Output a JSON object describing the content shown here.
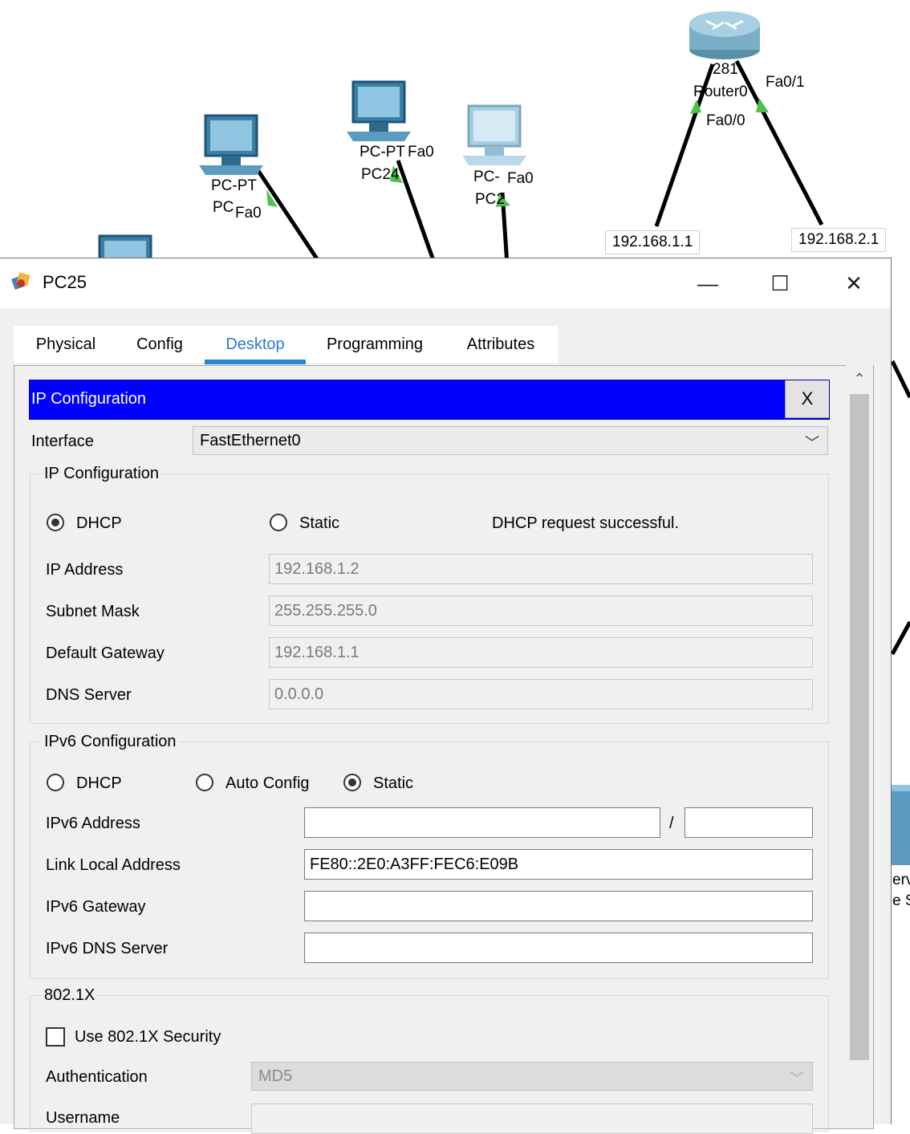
{
  "topology": {
    "router": {
      "model": "281",
      "name": "Router0",
      "port_left": "Fa0/0",
      "port_right": "Fa0/1"
    },
    "pcs": [
      {
        "model": "PC-PT",
        "name": "PC",
        "port": "Fa0"
      },
      {
        "model": "PC-PT",
        "name": "PC24",
        "port": "Fa0"
      },
      {
        "model": "PC-",
        "name": "PC2",
        "port": "Fa0"
      }
    ],
    "ip_labels": [
      "192.168.1.1",
      "192.168.2.1"
    ],
    "edge_text": [
      "erv",
      "e S"
    ]
  },
  "window": {
    "title": "PC25",
    "minimize_glyph": "—",
    "maximize_glyph": "☐",
    "close_glyph": "✕"
  },
  "tabs": [
    {
      "label": "Physical"
    },
    {
      "label": "Config"
    },
    {
      "label": "Desktop",
      "active": true
    },
    {
      "label": "Programming"
    },
    {
      "label": "Attributes"
    }
  ],
  "ipconfig": {
    "header": "IP Configuration",
    "close_label": "X",
    "interface_label": "Interface",
    "interface_value": "FastEthernet0",
    "ipv4": {
      "group_title": "IP Configuration",
      "dhcp_label": "DHCP",
      "static_label": "Static",
      "selected": "DHCP",
      "status": "DHCP request successful.",
      "fields": [
        {
          "label": "IP Address",
          "value": "192.168.1.2"
        },
        {
          "label": "Subnet Mask",
          "value": "255.255.255.0"
        },
        {
          "label": "Default Gateway",
          "value": "192.168.1.1"
        },
        {
          "label": "DNS Server",
          "value": "0.0.0.0"
        }
      ]
    },
    "ipv6": {
      "group_title": "IPv6 Configuration",
      "dhcp_label": "DHCP",
      "auto_label": "Auto Config",
      "static_label": "Static",
      "selected": "Static",
      "address_label": "IPv6 Address",
      "address_value": "",
      "prefix_separator": "/",
      "prefix_value": "",
      "link_local_label": "Link Local Address",
      "link_local_value": "FE80::2E0:A3FF:FEC6:E09B",
      "gateway_label": "IPv6 Gateway",
      "gateway_value": "",
      "dns_label": "IPv6 DNS Server",
      "dns_value": ""
    },
    "dot1x": {
      "group_title": "802.1X",
      "use_label": "Use 802.1X Security",
      "use_checked": false,
      "auth_label": "Authentication",
      "auth_value": "MD5",
      "username_label": "Username",
      "username_value": ""
    }
  }
}
